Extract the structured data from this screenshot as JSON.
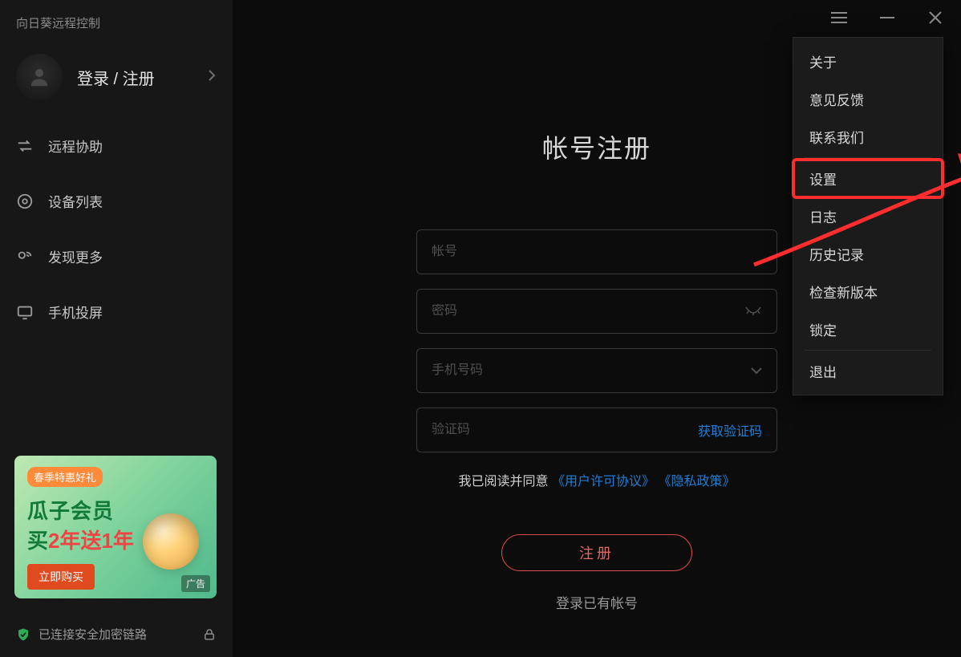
{
  "app_title": "向日葵远程控制",
  "login_label": "登录 / 注册",
  "nav": {
    "remote_assist": "远程协助",
    "device_list": "设备列表",
    "discover": "发现更多",
    "phone_cast": "手机投屏"
  },
  "promo": {
    "tag": "春季特惠好礼",
    "line1": "瓜子会员",
    "line2_a": "买",
    "line2_b": "2年送1年",
    "buy": "立即购买",
    "ad_badge": "广告"
  },
  "status_text": "已连接安全加密链路",
  "titlebar": {
    "menu": "≡",
    "minimize": "—",
    "close": "✕"
  },
  "form": {
    "title": "帐号注册",
    "account_ph": "帐号",
    "password_ph": "密码",
    "phone_ph": "手机号码",
    "captcha_ph": "验证码",
    "get_captcha": "获取验证码",
    "agreement_text": "我已阅读并同意",
    "agreement_link1": "《用户许可协议》",
    "agreement_link2": "《隐私政策》",
    "submit": "注册",
    "alt_login": "登录已有帐号"
  },
  "menu": {
    "about": "关于",
    "feedback": "意见反馈",
    "contact": "联系我们",
    "settings": "设置",
    "log": "日志",
    "history": "历史记录",
    "check_update": "检查新版本",
    "lock": "锁定",
    "exit": "退出"
  }
}
